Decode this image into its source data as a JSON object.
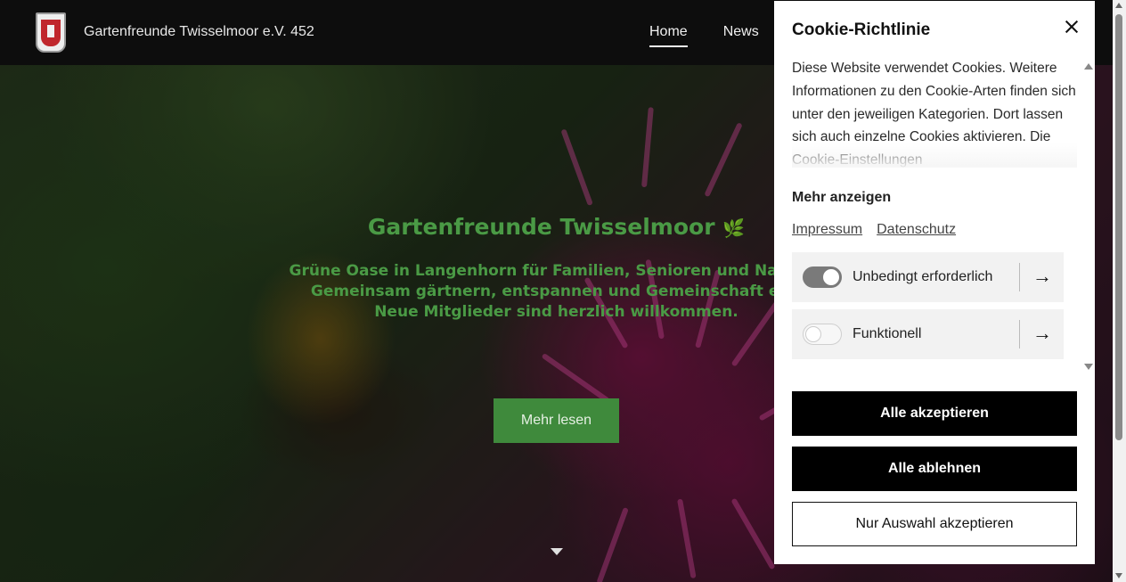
{
  "header": {
    "site_title": "Gartenfreunde Twisselmoor e.V. 452",
    "nav": [
      {
        "label": "Home",
        "active": true
      },
      {
        "label": "News",
        "active": false
      }
    ]
  },
  "hero": {
    "title": "Gartenfreunde Twisselmoor",
    "title_icon": "🌿",
    "subtitle_lines": [
      "Grüne Oase in Langenhorn für Familien, Senioren und Naturlie",
      "Gemeinsam gärtnern, entspannen und Gemeinschaft erle",
      "Neue Mitglieder sind herzlich willkommen."
    ],
    "button_label": "Mehr lesen",
    "accent_color": "#4a9a45"
  },
  "cookie": {
    "title": "Cookie-Richtlinie",
    "description": "Diese Website verwendet Cookies. Weitere Informationen zu den Cookie-Arten finden sich unter den jeweiligen Kategorien. Dort lassen sich auch einzelne Cookies aktivieren. Die Cookie-Einstellungen",
    "more_label": "Mehr anzeigen",
    "links": [
      "Impressum",
      "Datenschutz"
    ],
    "categories": [
      {
        "label": "Unbedingt erforderlich",
        "enabled": true
      },
      {
        "label": "Funktionell",
        "enabled": false
      }
    ],
    "buttons": {
      "accept_all": "Alle akzeptieren",
      "reject_all": "Alle ablehnen",
      "accept_selection": "Nur Auswahl akzeptieren"
    }
  }
}
